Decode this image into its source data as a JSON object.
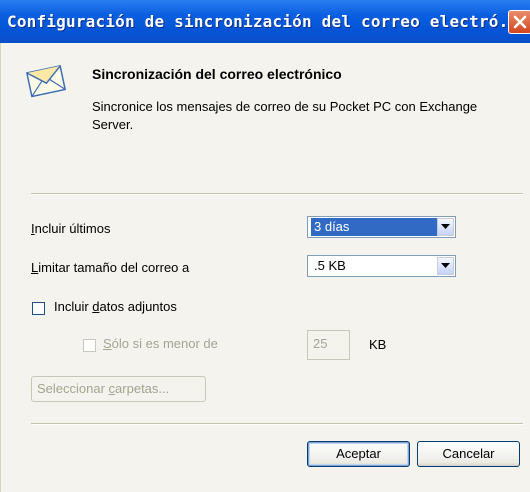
{
  "window": {
    "title": "Configuración de sincronización del correo electró..."
  },
  "header": {
    "title": "Sincronización del correo electrónico",
    "description": "Sincronice los mensajes de correo de su Pocket PC con Exchange Server."
  },
  "include_last": {
    "label_key": "I",
    "label_rest": "ncluir últimos",
    "value": "3 días"
  },
  "limit_size": {
    "label_key": "L",
    "label_rest": "imitar tamaño del correo a",
    "value": ".5 KB"
  },
  "include_attachments": {
    "label_pre": "Incluir ",
    "label_key": "d",
    "label_rest": "atos adjuntos",
    "checked": false
  },
  "only_if_smaller": {
    "label_key": "S",
    "label_rest": "ólo si es menor de",
    "value": "25",
    "unit": "KB",
    "checked": false
  },
  "select_folders": {
    "label_pre": "Seleccionar ",
    "label_key": "c",
    "label_rest": "arpetas..."
  },
  "buttons": {
    "ok": "Aceptar",
    "cancel": "Cancelar"
  },
  "icons": {
    "mail": "envelope-icon",
    "close": "close-icon",
    "dropdown": "chevron-down-icon"
  },
  "colors": {
    "title_bar": "#0554d6",
    "selection": "#316ac5",
    "close_button": "#d3461f"
  }
}
